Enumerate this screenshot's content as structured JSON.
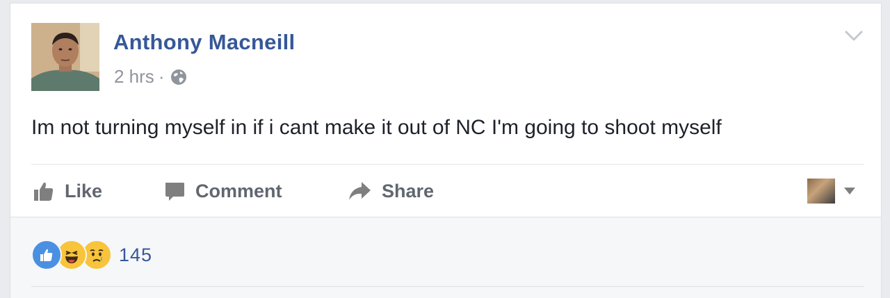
{
  "post": {
    "author": "Anthony Macneill",
    "time": "2 hrs",
    "separator": "·",
    "privacy_icon": "globe-icon",
    "text": "Im not turning myself in if i cant make it out of NC I'm going to shoot myself"
  },
  "actions": {
    "like_label": "Like",
    "comment_label": "Comment",
    "share_label": "Share"
  },
  "reactions": {
    "types": [
      "like",
      "haha",
      "sad"
    ],
    "count": "145"
  },
  "colors": {
    "link_blue": "#365899",
    "muted_gray": "#90949c",
    "action_gray": "#606770",
    "like_blue": "#4a90e2",
    "emoji_yellow": "#f7c43b"
  }
}
